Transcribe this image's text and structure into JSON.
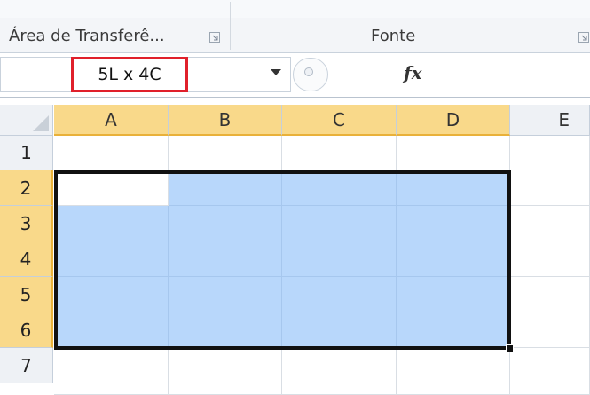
{
  "ribbon": {
    "groups": [
      {
        "label": "Área de Transferê...",
        "launcher_icon": "dialog-launcher-icon"
      },
      {
        "label": "Fonte",
        "launcher_icon": "dialog-launcher-icon"
      }
    ]
  },
  "formula_bar": {
    "name_box_value": "5L x 4C",
    "fx_label": "fx",
    "formula_value": ""
  },
  "sheet": {
    "columns": [
      "A",
      "B",
      "C",
      "D",
      "E"
    ],
    "rows": [
      "1",
      "2",
      "3",
      "4",
      "5",
      "6",
      "7"
    ],
    "selected_columns": [
      "A",
      "B",
      "C",
      "D"
    ],
    "selected_rows": [
      "2",
      "3",
      "4",
      "5",
      "6"
    ],
    "active_cell": "A2",
    "colors": {
      "selection_fill": "#b8d7fb",
      "header_selected": "#f9d98a",
      "name_box_border": "#e0202b"
    }
  }
}
